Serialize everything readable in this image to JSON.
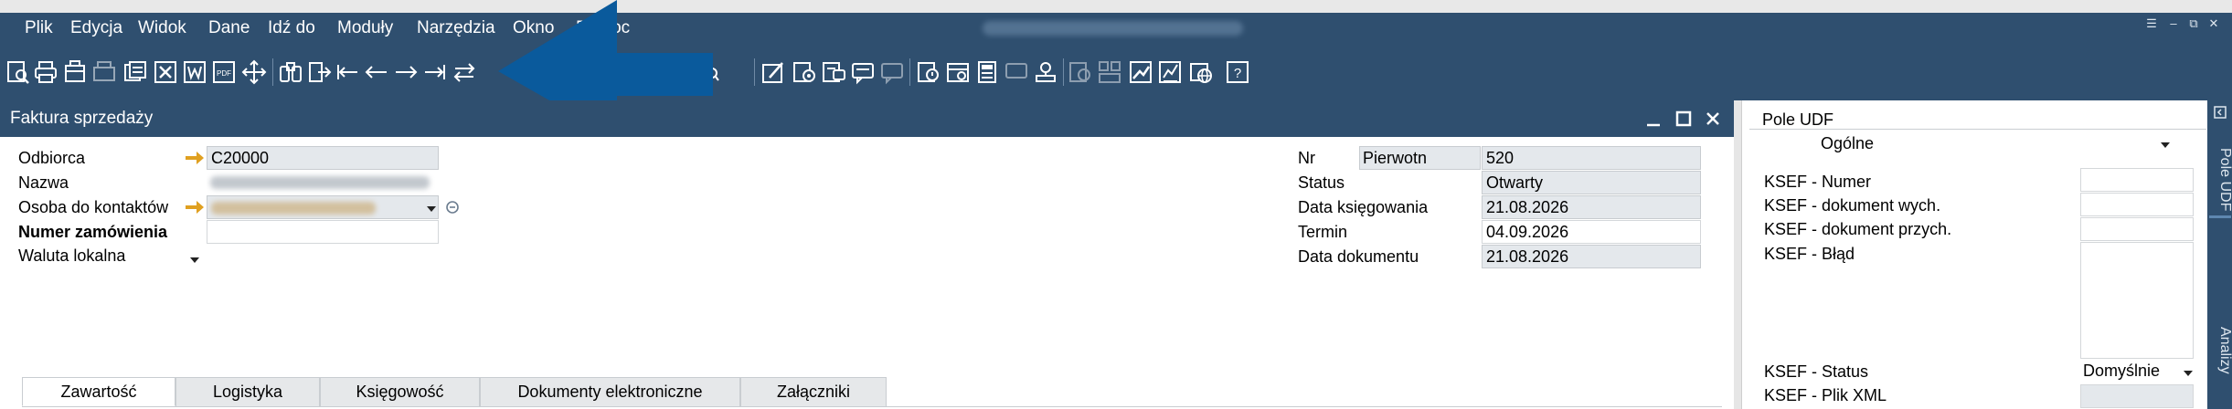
{
  "menubar": {
    "items": [
      "Plik",
      "Edycja",
      "Widok",
      "Dane",
      "Idź do",
      "Moduły",
      "Narzędzia",
      "Okno",
      "Pomoc"
    ]
  },
  "toolbar": {
    "icons": [
      "preview-icon",
      "print-icon",
      "print-form-icon",
      "fax-icon",
      "copy-icon",
      "excel-icon",
      "word-icon",
      "pdf-icon",
      "move-icon",
      "find-icon",
      "add-icon",
      "first-record-icon",
      "previous-record-icon",
      "next-record-icon",
      "last-record-icon",
      "swap-icon",
      "filter-icon",
      "sort-icon",
      "export-icon",
      "alert-icon",
      "form-settings-icon",
      "message-icon",
      "message-disabled-icon",
      "warning-icon",
      "calendar-icon",
      "calculator-icon",
      "chat-disabled-icon",
      "stamp-icon",
      "refresh-disabled-icon",
      "layout-disabled-icon",
      "trend-icon",
      "report-icon",
      "web-icon",
      "help-icon"
    ]
  },
  "document": {
    "title": "Faktura sprzedaży",
    "left_fields": {
      "odbiorca_label": "Odbiorca",
      "odbiorca_value": "C20000",
      "nazwa_label": "Nazwa",
      "osoba_label": "Osoba do kontaktów",
      "numer_zamowienia_label": "Numer zamówienia",
      "numer_zamowienia_value": "",
      "waluta_label": "Waluta lokalna"
    },
    "right_fields": {
      "nr_label": "Nr",
      "nr_series": "Pierwotn",
      "nr_value": "520",
      "status_label": "Status",
      "status_value": "Otwarty",
      "data_ksiegowania_label": "Data księgowania",
      "data_ksiegowania_value": "21.08.2026",
      "termin_label": "Termin",
      "termin_value": "04.09.2026",
      "data_dokumentu_label": "Data dokumentu",
      "data_dokumentu_value": "21.08.2026"
    },
    "tabs": [
      "Zawartość",
      "Logistyka",
      "Księgowość",
      "Dokumenty elektroniczne",
      "Załączniki"
    ]
  },
  "udf": {
    "title": "Pole UDF",
    "category": "Ogólne",
    "fields": [
      {
        "label": "KSEF - Numer",
        "value": ""
      },
      {
        "label": "KSEF - dokument wych.",
        "value": ""
      },
      {
        "label": "KSEF - dokument przych.",
        "value": ""
      },
      {
        "label": "KSEF - Błąd",
        "value": ""
      },
      {
        "label": "KSEF - Status",
        "value": "Domyślnie"
      },
      {
        "label": "KSEF - Plik XML",
        "value": ""
      }
    ],
    "side_tabs": [
      "Pole UDF",
      "Analizy"
    ]
  },
  "colors": {
    "chrome": "#2f4f6f",
    "arrow": "#0a5a9c",
    "field_bg": "#e4e8ec",
    "link_arrow": "#e0a020"
  }
}
